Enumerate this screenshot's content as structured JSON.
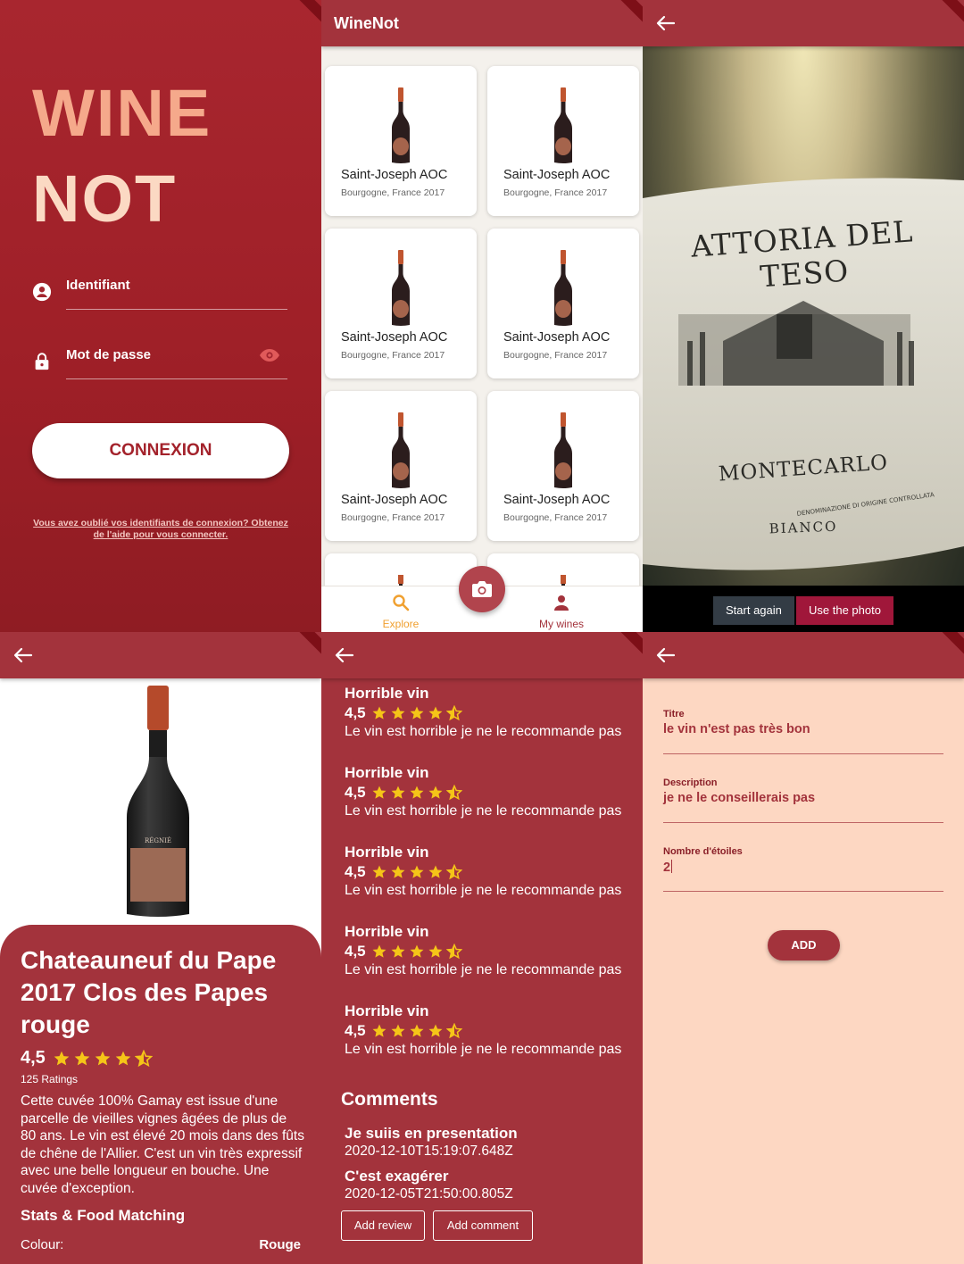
{
  "colors": {
    "brand": "#a3333c",
    "login_bg": "#9e1f27",
    "logo_top": "#f5a98b",
    "logo_bottom": "#fbd9c3",
    "star": "#f5c518",
    "form_bg": "#fdd7c2",
    "nav_active": "#f0a030",
    "nav_inactive": "#a3333c",
    "use_photo_bg": "#a0173a",
    "start_again_bg": "#333c45"
  },
  "login": {
    "logo_line1": "WINE",
    "logo_line2": "NOT",
    "username_label": "Identifiant",
    "password_label": "Mot de passe",
    "submit_label": "CONNEXION",
    "forgot_text": "Vous avez oublié vos identifiants de connexion? Obtenez de l'aide pour vous connecter.",
    "icons": {
      "user": "account-circle-icon",
      "lock": "lock-icon",
      "eye": "eye-icon"
    }
  },
  "explore": {
    "app_title": "WineNot",
    "cards": [
      {
        "name": "Saint-Joseph AOC",
        "origin": "Bourgogne, France 2017"
      },
      {
        "name": "Saint-Joseph AOC",
        "origin": "Bourgogne, France 2017"
      },
      {
        "name": "Saint-Joseph AOC",
        "origin": "Bourgogne, France 2017"
      },
      {
        "name": "Saint-Joseph AOC",
        "origin": "Bourgogne, France 2017"
      },
      {
        "name": "Saint-Joseph AOC",
        "origin": "Bourgogne, France 2017"
      },
      {
        "name": "Saint-Joseph AOC",
        "origin": "Bourgogne, France 2017"
      }
    ],
    "nav": {
      "explore_label": "Explore",
      "mywines_label": "My wines"
    }
  },
  "camera": {
    "label_line1": "ATTORIA DEL TESO",
    "label_line2": "MONTECARLO",
    "label_line3": "BIANCO",
    "label_small": "DENOMINAZIONE DI ORIGINE CONTROLLATA",
    "start_again_label": "Start again",
    "use_photo_label": "Use the photo"
  },
  "detail": {
    "title": "Chateauneuf du Pape 2017 Clos des Papes rouge",
    "rating": "4,5",
    "stars": 4.5,
    "ratings_count": "125 Ratings",
    "description": "Cette cuvée 100% Gamay est issue d'une parcelle de vieilles vignes âgées de plus de 80 ans. Le vin est élevé 20 mois dans des fûts de chêne de l'Allier. C'est un vin très expressif avec une belle longueur en bouche. Une cuvée d'exception.",
    "stats_title": "Stats & Food Matching",
    "colour_label": "Colour:",
    "colour_value": "Rouge",
    "bottle_label": "RÉGNIÉ"
  },
  "reviews": {
    "items": [
      {
        "title": "Horrible vin",
        "rating": "4,5",
        "stars": 4.5,
        "text": "Le vin est horrible je ne le recommande pas"
      },
      {
        "title": "Horrible vin",
        "rating": "4,5",
        "stars": 4.5,
        "text": "Le vin est horrible je ne le recommande pas"
      },
      {
        "title": "Horrible vin",
        "rating": "4,5",
        "stars": 4.5,
        "text": "Le vin est horrible je ne le recommande pas"
      },
      {
        "title": "Horrible vin",
        "rating": "4,5",
        "stars": 4.5,
        "text": "Le vin est horrible je ne le recommande pas"
      },
      {
        "title": "Horrible vin",
        "rating": "4,5",
        "stars": 4.5,
        "text": "Le vin est horrible je ne le recommande pas"
      }
    ],
    "comments_title": "Comments",
    "comments": [
      {
        "title": "Je suiis en presentation",
        "date": "2020-12-10T15:19:07.648Z"
      },
      {
        "title": "C'est exagérer",
        "date": "2020-12-05T21:50:00.805Z"
      }
    ],
    "add_review_label": "Add review",
    "add_comment_label": "Add comment"
  },
  "form": {
    "title_label": "Titre",
    "title_value": "le vin n'est pas très bon",
    "description_label": "Description",
    "description_value": "je ne le conseillerais pas",
    "stars_label": "Nombre d'étoiles",
    "stars_value": "2",
    "submit_label": "ADD"
  }
}
